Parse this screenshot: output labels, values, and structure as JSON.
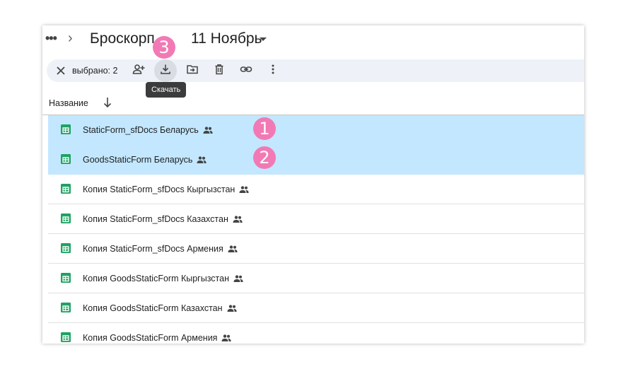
{
  "breadcrumb": {
    "more": "•••",
    "separator": "›",
    "parent": "Броскорп",
    "current": "11 Ноябрь"
  },
  "toolbar": {
    "selected_text": "выбрано: 2",
    "actions": [
      "close-icon",
      "share-icon",
      "download-icon",
      "move-icon",
      "delete-icon",
      "link-icon",
      "more-vert-icon"
    ],
    "tooltip": "Скачать"
  },
  "list": {
    "column_header": "Название",
    "sort": "descending",
    "rows": [
      {
        "name": "StaticForm_sfDocs Беларусь",
        "selected": true
      },
      {
        "name": "GoodsStaticForm Беларусь",
        "selected": true
      },
      {
        "name": "Копия StaticForm_sfDocs Кыргызстан",
        "selected": false
      },
      {
        "name": "Копия StaticForm_sfDocs Казахстан",
        "selected": false
      },
      {
        "name": "Копия StaticForm_sfDocs Армения",
        "selected": false
      },
      {
        "name": "Копия GoodsStaticForm Кыргызстан",
        "selected": false
      },
      {
        "name": "Копия GoodsStaticForm Казахстан",
        "selected": false
      },
      {
        "name": "Копия GoodsStaticForm Армения",
        "selected": false
      }
    ]
  },
  "markers": [
    "1",
    "2",
    "3"
  ],
  "colors": {
    "selected_row": "#c2e7ff",
    "toolbar_bg": "#eef2f8",
    "marker": "#f17ab5",
    "sheets_green": "#1ea362",
    "tooltip_bg": "#3c3c3c"
  }
}
